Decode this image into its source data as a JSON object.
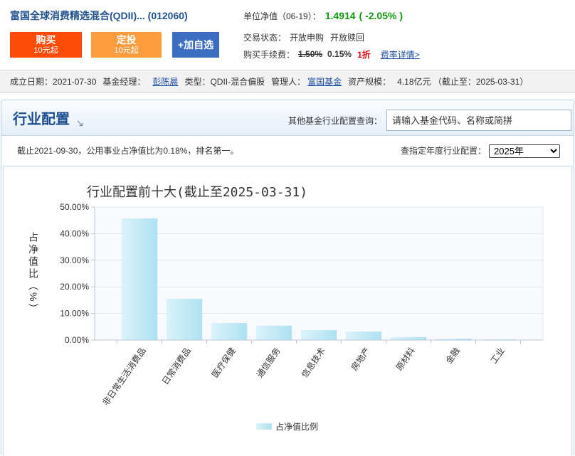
{
  "fund": {
    "title": "富国全球消费精选混合(QDII)... (012060)",
    "buttons": {
      "buy": {
        "label": "购买",
        "sub": "10元起"
      },
      "auto_invest": {
        "label": "定投",
        "sub": "10元起"
      },
      "add_watch": {
        "label": "+加自选"
      }
    },
    "nav": {
      "label": "单位净值（06-19）：",
      "value": "1.4914",
      "change": "( -2.05% )"
    },
    "trade_status": {
      "label": "交易状态：",
      "purchase": "开放申购",
      "redeem": "开放赎回"
    },
    "fee": {
      "label": "购买手续费：",
      "original": "1.50%",
      "current": "0.15%",
      "discount": "1折",
      "detail_link": "费率详情>"
    }
  },
  "info_bar": {
    "established_label": "成立日期：",
    "established": "2021-07-30",
    "manager_label": "基金经理：",
    "manager": "彭陈晨",
    "type_label": "类型：",
    "type": "QDII-混合偏股",
    "company_label": "管理人：",
    "company": "富国基金",
    "size_label": "资产规模：",
    "size": "4.18亿元 （截止至：2025-03-31）"
  },
  "section": {
    "title": "行业配置",
    "query_label": "其他基金行业配置查询：",
    "query_placeholder": "请输入基金代码、名称或简拼",
    "note": "截止2021-09-30，公用事业占净值比为0.18%，排名第一。",
    "year_label": "查指定年度行业配置：",
    "year_selected": "2025年"
  },
  "icons": {
    "section_title_arrow": "arrow-down-right-icon"
  },
  "colors": {
    "fund_title": "#22528f",
    "buy_button": "#fd4c0a",
    "auto_invest_button": "#fb9c3f",
    "watchlist_button": "#3d6dc1",
    "nav_down": "#129a12",
    "discount": "#e60012",
    "link": "#1f4fa0",
    "section_title": "#1d4f8f",
    "bar_light": "#dcf3fb",
    "bar_dark": "#ade1f1"
  },
  "chart_data": {
    "type": "bar",
    "title": "行业配置前十大(截止至2025-03-31)",
    "ylabel": "占净值比（%）",
    "categories": [
      "非日常生活消费品",
      "日常消费品",
      "医疗保健",
      "通信服务",
      "信息技术",
      "房地产",
      "原材料",
      "金融",
      "工业"
    ],
    "series": [
      {
        "name": "占净值比例",
        "values": [
          45.7,
          15.5,
          6.4,
          5.4,
          3.7,
          3.2,
          1.1,
          0.5,
          0.3
        ]
      }
    ],
    "ylim": [
      0,
      50
    ],
    "y_tick_labels": [
      "0.00%",
      "10.00%",
      "20.00%",
      "30.00%",
      "40.00%",
      "50.00%"
    ],
    "grid": true,
    "legend": "bottom-center"
  }
}
